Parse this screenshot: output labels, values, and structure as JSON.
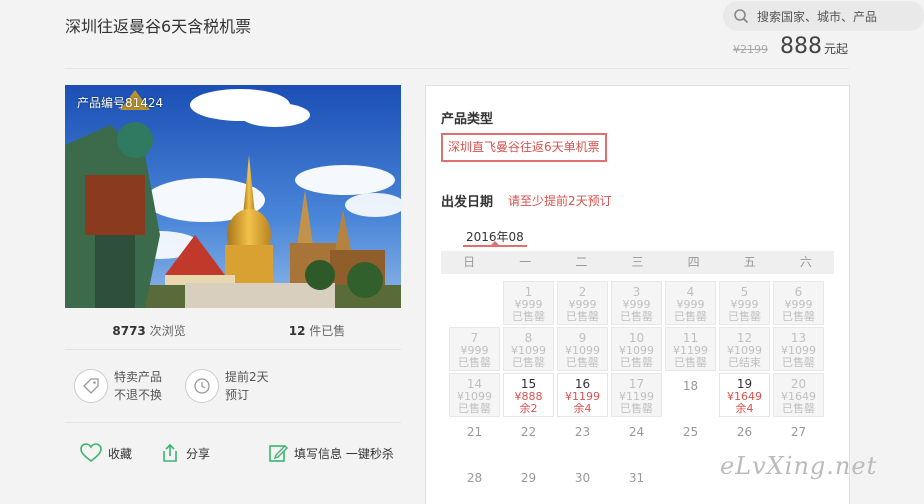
{
  "header": {
    "title": "深圳往返曼谷6天含税机票",
    "search_placeholder": "搜索国家、城市、产品",
    "old_price": "¥2199",
    "price": "888",
    "price_unit": "元起"
  },
  "photo": {
    "code": "产品编号81424"
  },
  "stats": {
    "views_num": "8773",
    "views_label": " 次浏览",
    "sold_num": "12",
    "sold_label": " 件已售"
  },
  "features": {
    "special_line1": "特卖产品",
    "special_line2": "不退不换",
    "advance_line1": "提前2天",
    "advance_line2": "预订"
  },
  "actions": {
    "favorite": "收藏",
    "share": "分享",
    "fill_info": "填写信息 一键秒杀"
  },
  "booking": {
    "type_label": "产品类型",
    "type_value": "深圳直飞曼谷往返6天单机票",
    "date_label": "出发日期",
    "date_note": "请至少提前2天预订",
    "month": "2016年08",
    "weekdays": [
      "日",
      "一",
      "二",
      "三",
      "四",
      "五",
      "六"
    ]
  },
  "calendar": [
    {
      "day": "",
      "price": "",
      "status": "",
      "state": "empty"
    },
    {
      "day": "1",
      "price": "¥999",
      "status": "已售罄",
      "state": "dis"
    },
    {
      "day": "2",
      "price": "¥999",
      "status": "已售罄",
      "state": "dis"
    },
    {
      "day": "3",
      "price": "¥999",
      "status": "已售罄",
      "state": "dis"
    },
    {
      "day": "4",
      "price": "¥999",
      "status": "已售罄",
      "state": "dis"
    },
    {
      "day": "5",
      "price": "¥999",
      "status": "已售罄",
      "state": "dis"
    },
    {
      "day": "6",
      "price": "¥999",
      "status": "已售罄",
      "state": "dis"
    },
    {
      "day": "7",
      "price": "¥999",
      "status": "已售罄",
      "state": "dis"
    },
    {
      "day": "8",
      "price": "¥1099",
      "status": "已售罄",
      "state": "dis"
    },
    {
      "day": "9",
      "price": "¥1099",
      "status": "已售罄",
      "state": "dis"
    },
    {
      "day": "10",
      "price": "¥1099",
      "status": "已售罄",
      "state": "dis"
    },
    {
      "day": "11",
      "price": "¥1199",
      "status": "已售罄",
      "state": "dis"
    },
    {
      "day": "12",
      "price": "¥1099",
      "status": "已结束",
      "state": "dis"
    },
    {
      "day": "13",
      "price": "¥1099",
      "status": "已售罄",
      "state": "dis"
    },
    {
      "day": "14",
      "price": "¥1099",
      "status": "已售罄",
      "state": "dis"
    },
    {
      "day": "15",
      "price": "¥888",
      "status": "余2",
      "state": "avail"
    },
    {
      "day": "16",
      "price": "¥1199",
      "status": "余4",
      "state": "avail"
    },
    {
      "day": "17",
      "price": "¥1199",
      "status": "已售罄",
      "state": "dis"
    },
    {
      "day": "18",
      "price": "",
      "status": "",
      "state": "plain"
    },
    {
      "day": "19",
      "price": "¥1649",
      "status": "余4",
      "state": "avail"
    },
    {
      "day": "20",
      "price": "¥1649",
      "status": "已售罄",
      "state": "dis"
    },
    {
      "day": "21",
      "price": "",
      "status": "",
      "state": "plain"
    },
    {
      "day": "22",
      "price": "",
      "status": "",
      "state": "plain"
    },
    {
      "day": "23",
      "price": "",
      "status": "",
      "state": "plain"
    },
    {
      "day": "24",
      "price": "",
      "status": "",
      "state": "plain"
    },
    {
      "day": "25",
      "price": "",
      "status": "",
      "state": "plain"
    },
    {
      "day": "26",
      "price": "",
      "status": "",
      "state": "plain"
    },
    {
      "day": "27",
      "price": "",
      "status": "",
      "state": "plain"
    },
    {
      "day": "28",
      "price": "",
      "status": "",
      "state": "plain"
    },
    {
      "day": "29",
      "price": "",
      "status": "",
      "state": "plain"
    },
    {
      "day": "30",
      "price": "",
      "status": "",
      "state": "plain"
    },
    {
      "day": "31",
      "price": "",
      "status": "",
      "state": "plain"
    }
  ],
  "watermark": "eLvXing.net",
  "icons": {
    "search": "search-icon",
    "tag": "tag-icon",
    "clock": "clock-icon",
    "heart": "heart-icon",
    "share": "share-icon",
    "edit": "edit-icon"
  },
  "colors": {
    "accent": "#d9534f",
    "icon_green": "#3cb371"
  }
}
